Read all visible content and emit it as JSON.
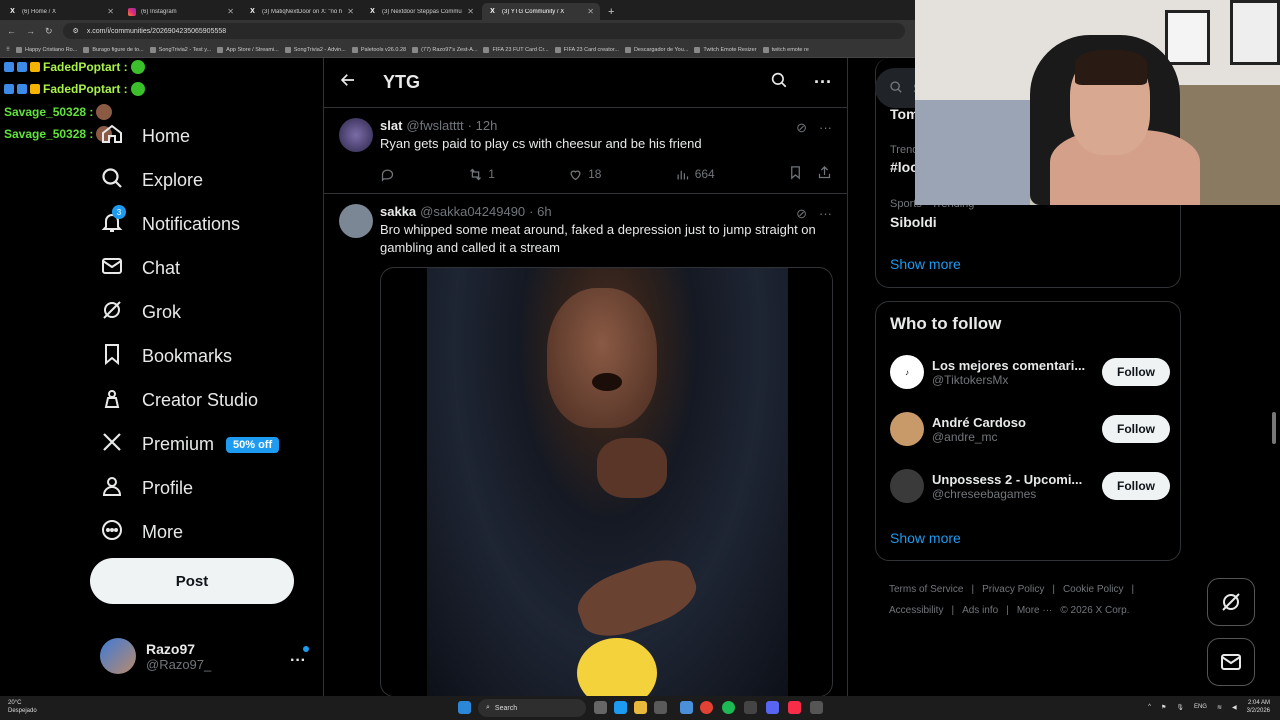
{
  "browser": {
    "tabs": [
      {
        "label": "(6) Home / X",
        "icon": "x-icon",
        "active": false
      },
      {
        "label": "(6) Instagram",
        "icon": "instagram-icon",
        "active": false
      },
      {
        "label": "(3) MatiqNextDoor on X: \"no h",
        "icon": "x-icon",
        "active": false
      },
      {
        "label": "(3) Nextdoor Steppas Commu",
        "icon": "x-icon",
        "active": false
      },
      {
        "label": "(3) YTG Community / X",
        "icon": "x-icon",
        "active": true
      }
    ],
    "url": "x.com/i/communities/2026904235065905558",
    "bookmarks": [
      "Happy Cristiano Ro...",
      "Burago figure de to...",
      "SongTrivia2 - Test y...",
      "App Store / Streami...",
      "SongTrivia2 - Advin...",
      "Paletools v26.0.28",
      "(77) Razo97's Zest-A...",
      "FIFA 23 FUT Card Cr...",
      "FIFA 23 Card creator...",
      "Descargador de You...",
      "Twitch Emote Resizer",
      "twitch emote re"
    ]
  },
  "chat": [
    {
      "user": "FadedPoptart :"
    },
    {
      "user": "FadedPoptart :"
    },
    {
      "user": "Savage_50328 :"
    },
    {
      "user": "Savage_50328 :"
    }
  ],
  "nav": {
    "home": "Home",
    "explore": "Explore",
    "notifications": "Notifications",
    "notifications_count": "3",
    "chat": "Chat",
    "grok": "Grok",
    "bookmarks": "Bookmarks",
    "creator_studio": "Creator Studio",
    "premium": "Premium",
    "premium_badge": "50% off",
    "profile": "Profile",
    "more": "More",
    "post": "Post"
  },
  "account": {
    "name": "Razo97",
    "handle": "@Razo97_",
    "more": "···"
  },
  "feed": {
    "title": "YTG",
    "tweets": [
      {
        "name": "slat",
        "handle": "@fwslatttt",
        "time": "· 12h",
        "text": "Ryan gets paid to play cs with cheesur and be his friend",
        "reposts": "1",
        "likes": "18",
        "views": "664"
      },
      {
        "name": "sakka",
        "handle": "@sakka04249490",
        "time": "· 6h",
        "text": "Bro whipped some meat around, faked a depression just to jump straight on gambling and called it a stream"
      }
    ]
  },
  "sidebar": {
    "search_placeholder": "Se",
    "trends": [
      {
        "category": "",
        "name": "Tom"
      },
      {
        "category": "Trend",
        "name": "#loc"
      },
      {
        "category": "Sports · Trending",
        "name": "Siboldi"
      }
    ],
    "show_more": "Show more",
    "who_to_follow_title": "Who to follow",
    "who": [
      {
        "name": "Los mejores comentari...",
        "handle": "@TiktokersMx",
        "button": "Follow",
        "avatar_color": "#ffffff"
      },
      {
        "name": "André Cardoso",
        "handle": "@andre_mc",
        "button": "Follow",
        "avatar_color": "#c89a6a"
      },
      {
        "name": "Unpossess 2 - Upcomi...",
        "handle": "@chreseebagames",
        "button": "Follow",
        "avatar_color": "#3a3a3a"
      }
    ],
    "show_more_2": "Show more",
    "footer": [
      "Terms of Service",
      "|",
      "Privacy Policy",
      "|",
      "Cookie Policy",
      "|",
      "Accessibility",
      "|",
      "Ads info",
      "|",
      "More ···",
      "© 2026 X Corp."
    ]
  },
  "taskbar": {
    "temp": "20°C",
    "weather": "Despejado",
    "search": "Search",
    "lang": "ENG",
    "time": "2:04 AM",
    "date": "3/2/2026"
  },
  "colors": {
    "accent": "#1d9bf0",
    "background": "#000000",
    "chat_name": "#a9f24a"
  }
}
